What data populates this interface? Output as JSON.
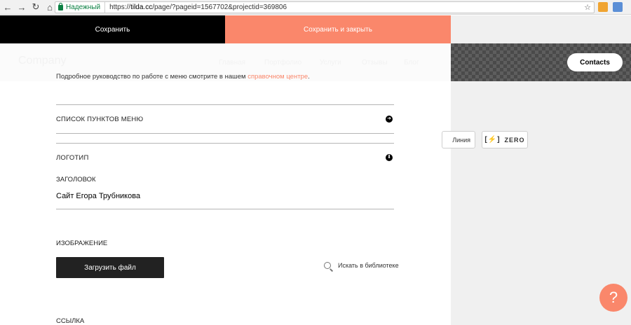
{
  "browser": {
    "secure_label": "Надежный",
    "url_scheme": "https://",
    "url_host": "tilda.cc",
    "url_path": "/page/?pageid=1567702&projectid=369806"
  },
  "actions": {
    "save_label": "Сохранить",
    "save_close_label": "Сохранить и закрыть"
  },
  "preview": {
    "ghost_logo": "Company",
    "ghost_menu": [
      "Главная",
      "Портфолио",
      "Услуги",
      "Отзывы",
      "Блог"
    ],
    "contacts_label": "Contacts",
    "line_label": "Линия",
    "zero_label": "ZERO",
    "help_label": "?"
  },
  "panel": {
    "hint_text": "Подробное руководство по работе с меню смотрите в нашем ",
    "hint_link": "справочном центре",
    "hint_end": ".",
    "menu_items_label": "СПИСОК ПУНКТОВ МЕНЮ",
    "logo_label": "ЛОГОТИП",
    "title_label": "ЗАГОЛОВОК",
    "title_value": "Сайт Егора Трубникова",
    "image_label": "ИЗОБРАЖЕНИЕ",
    "upload_label": "Загрузить файл",
    "library_search_label": "Искать в библиотеке",
    "link_label": "ССЫЛКА"
  },
  "colors": {
    "accent": "#fa876b",
    "dark": "#000000",
    "secure_green": "#0b8043"
  }
}
